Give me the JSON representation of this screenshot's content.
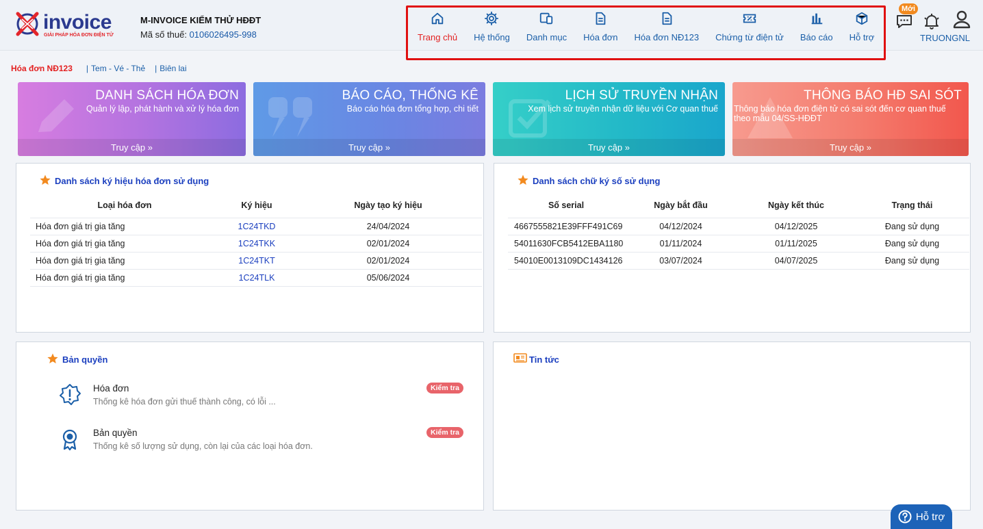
{
  "header": {
    "logo_text": "invoice",
    "logo_sub": "GIẢI PHÁP HÓA ĐƠN ĐIỆN TỬ",
    "company": "M-INVOICE KIỂM THỬ HĐĐT",
    "tax_label": "Mã số thuế:",
    "tax_value": "0106026495-998",
    "nav": [
      {
        "label": "Trang chủ",
        "icon": "home-icon"
      },
      {
        "label": "Hệ thống",
        "icon": "gear-icon"
      },
      {
        "label": "Danh mục",
        "icon": "devices-icon"
      },
      {
        "label": "Hóa đơn",
        "icon": "document-icon"
      },
      {
        "label": "Hóa đơn NĐ123",
        "icon": "document-icon"
      },
      {
        "label": "Chứng từ điện tử",
        "icon": "ticket-icon"
      },
      {
        "label": "Báo cáo",
        "icon": "bar-chart-icon"
      },
      {
        "label": "Hỗ trợ",
        "icon": "box-icon"
      }
    ],
    "new_badge": "Mới",
    "username": "TRUONGNL"
  },
  "subtabs": {
    "active": "Hóa đơn NĐ123",
    "tab2": "Tem - Vé - Thẻ",
    "tab3": "Biên lai",
    "sep": "|"
  },
  "cards": [
    {
      "title": "DANH SÁCH HÓA ĐƠN",
      "desc": "Quản lý lập, phát hành và xử lý hóa đơn",
      "cta": "Truy cập »"
    },
    {
      "title": "BÁO CÁO, THỐNG KÊ",
      "desc": "Báo cáo hóa đơn tổng hợp, chi tiết",
      "cta": "Truy cập »"
    },
    {
      "title": "LỊCH SỬ TRUYỀN NHẬN",
      "desc": "Xem lịch sử truyền nhận dữ liệu với Cơ quan thuế",
      "cta": "Truy cập »"
    },
    {
      "title": "THÔNG BÁO HĐ SAI SÓT",
      "desc": "Thông báo hóa đơn điện tử có sai sót đến cơ quan thuế theo mẫu 04/SS-HĐĐT",
      "cta": "Truy cập »"
    }
  ],
  "symbols": {
    "title": "Danh sách ký hiệu hóa đơn sử dụng",
    "headers": [
      "Loại hóa đơn",
      "Ký hiệu",
      "Ngày tạo ký hiệu"
    ],
    "rows": [
      [
        "Hóa đơn giá trị gia tăng",
        "1C24TKD",
        "24/04/2024"
      ],
      [
        "Hóa đơn giá trị gia tăng",
        "1C24TKK",
        "02/01/2024"
      ],
      [
        "Hóa đơn giá trị gia tăng",
        "1C24TKT",
        "02/01/2024"
      ],
      [
        "Hóa đơn giá trị gia tăng",
        "1C24TLK",
        "05/06/2024"
      ]
    ]
  },
  "signatures": {
    "title": "Danh sách chữ ký số sử dụng",
    "headers": [
      "Số serial",
      "Ngày bắt đầu",
      "Ngày kết thúc",
      "Trạng thái"
    ],
    "rows": [
      [
        "4667555821E39FFF491C69",
        "04/12/2024",
        "04/12/2025",
        "Đang sử dụng"
      ],
      [
        "54011630FCB5412EBA1180",
        "01/11/2024",
        "01/11/2025",
        "Đang sử dụng"
      ],
      [
        "54010E0013109DC1434126",
        "03/07/2024",
        "04/07/2025",
        "Đang sử dụng"
      ]
    ]
  },
  "license": {
    "title": "Bản quyền",
    "items": [
      {
        "title": "Hóa đơn",
        "desc": "Thống kê hóa đơn gửi thuế thành công, có lỗi ...",
        "action": "Kiểm tra"
      },
      {
        "title": "Bản quyền",
        "desc": "Thống kê số lượng sử dụng, còn lại của các loại hóa đơn.",
        "action": "Kiểm tra"
      }
    ]
  },
  "news": {
    "title": "Tin tức"
  },
  "help_button": "Hỗ trợ",
  "colors": {
    "accent": "#1b5fa8",
    "active": "#e32121",
    "title_blue": "#1b3fbf",
    "star": "#f28a1f",
    "highlight_box": "#e01010"
  }
}
